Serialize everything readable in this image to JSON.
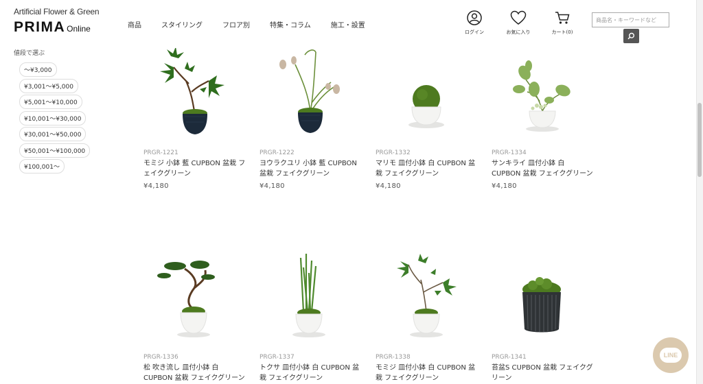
{
  "header": {
    "logo_tagline": "Artificial Flower & Green",
    "logo_prima": "PRIMA",
    "logo_online": "Online",
    "nav": [
      {
        "label": "商品"
      },
      {
        "label": "スタイリング"
      },
      {
        "label": "フロア別"
      },
      {
        "label": "特集・コラム"
      },
      {
        "label": "施工・設置"
      }
    ],
    "login_label": "ログイン",
    "favorites_label": "お気に入り",
    "cart_label": "カート(0)",
    "search_placeholder": "商品名・キーワードなど",
    "icons": {
      "login": "user-circle-icon",
      "favorites": "heart-icon",
      "cart": "cart-icon",
      "search": "search-icon"
    }
  },
  "sidebar": {
    "title": "値段で選ぶ",
    "price_ranges": [
      "〜¥3,000",
      "¥3,001〜¥5,000",
      "¥5,001〜¥10,000",
      "¥10,001〜¥30,000",
      "¥30,001〜¥50,000",
      "¥50,001〜¥100,000",
      "¥100,001〜"
    ]
  },
  "products": [
    {
      "sku": "PRGR-1221",
      "name": "モミジ 小鉢 藍 CUPBON 盆栽 フェイクグリーン",
      "price": "¥4,180"
    },
    {
      "sku": "PRGR-1222",
      "name": "ヨウラクユリ 小鉢 藍 CUPBON 盆栽 フェイクグリーン",
      "price": "¥4,180"
    },
    {
      "sku": "PRGR-1332",
      "name": "マリモ 皿付小鉢 白 CUPBON 盆栽 フェイクグリーン",
      "price": "¥4,180"
    },
    {
      "sku": "PRGR-1334",
      "name": "サンキライ 皿付小鉢 白 CUPBON 盆栽 フェイクグリーン",
      "price": "¥4,180"
    },
    {
      "sku": "PRGR-1336",
      "name": "松 吹き流し 皿付小鉢 白 CUPBON 盆栽 フェイクグリーン",
      "price": ""
    },
    {
      "sku": "PRGR-1337",
      "name": "トクサ 皿付小鉢 白 CUPBON 盆栽 フェイクグリーン",
      "price": ""
    },
    {
      "sku": "PRGR-1338",
      "name": "モミジ 皿付小鉢 白 CUPBON 盆栽 フェイクグリーン",
      "price": ""
    },
    {
      "sku": "PRGR-1341",
      "name": "苔盆S CUPBON 盆栽 フェイクグリーン",
      "price": ""
    }
  ],
  "line_button": {
    "label": "LINE"
  },
  "colors": {
    "navy_pot": "#1c2a3a",
    "white_pot": "#f4f4f2",
    "moss": "#4d7a1f",
    "leaf": "#3f7d2a",
    "line_badge": "#d8c4a6"
  }
}
